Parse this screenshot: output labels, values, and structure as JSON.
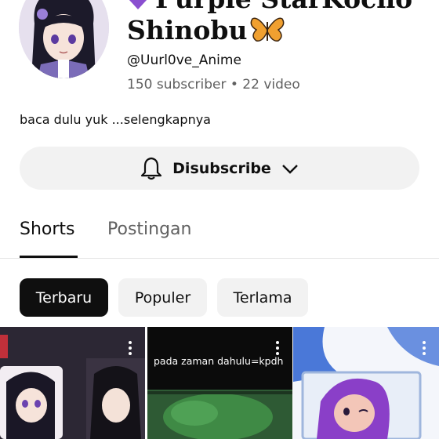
{
  "channel": {
    "name_line1": "Purple StarKocho",
    "name_line2": "Shinobu",
    "handle": "@Uurl0ve_Anime",
    "subscribers": "150 subscriber",
    "separator": "•",
    "videos": "22 video",
    "description": "baca dulu yuk",
    "more_label": "...selengkapnya"
  },
  "subscribe_button": {
    "label": "Disubscribe"
  },
  "tabs": [
    {
      "label": "Shorts",
      "active": true
    },
    {
      "label": "Postingan",
      "active": false
    }
  ],
  "chips": [
    {
      "label": "Terbaru",
      "selected": true
    },
    {
      "label": "Populer",
      "selected": false
    },
    {
      "label": "Terlama",
      "selected": false
    }
  ],
  "shorts": [
    {
      "caption": ""
    },
    {
      "caption": "pada zaman dahulu=kpdh"
    },
    {
      "caption": ""
    }
  ],
  "icons": {
    "avatar": "anime-girl-avatar",
    "name_emoji_1": "purple-heart-icon",
    "name_emoji_2": "butterfly-icon",
    "bell": "bell-icon",
    "chevron": "chevron-down-icon",
    "more": "more-vert-icon"
  },
  "colors": {
    "text_primary": "#0f0f0f",
    "text_secondary": "#606060",
    "chip_selected_bg": "#0f0f0f",
    "chip_bg": "#f2f2f2"
  }
}
